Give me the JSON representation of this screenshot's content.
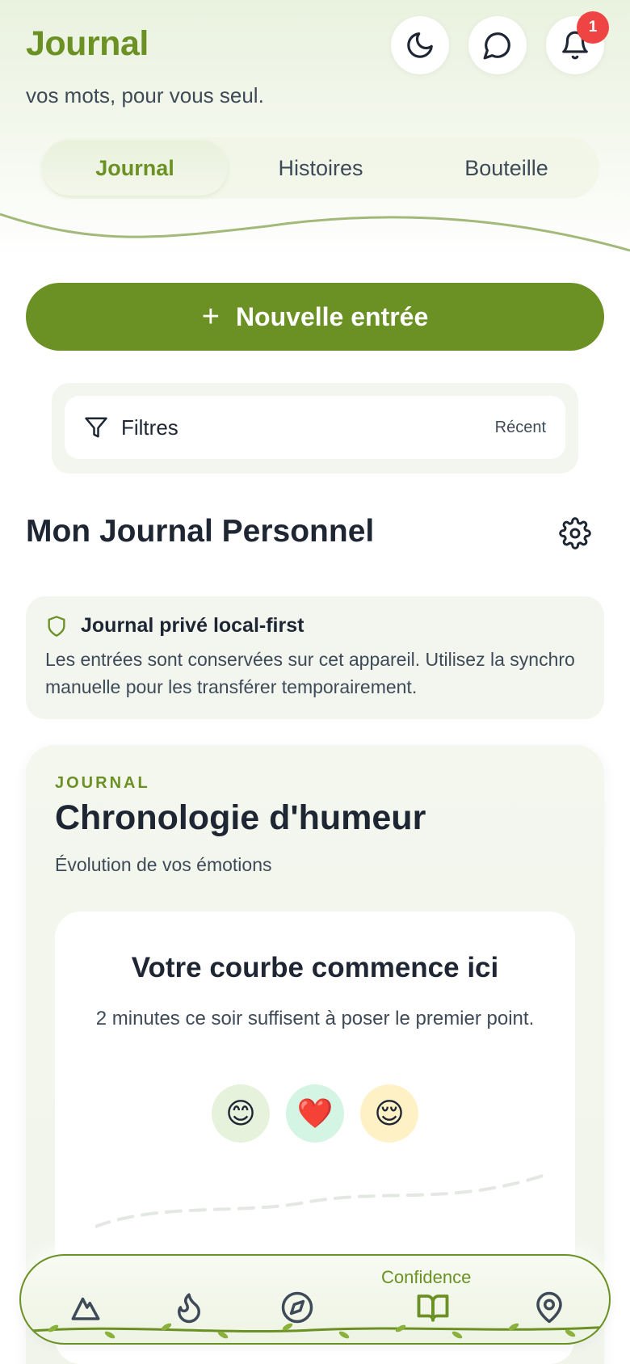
{
  "header": {
    "title": "Journal",
    "tagline": "vos mots, pour vous seul.",
    "icons": [
      "moon-icon",
      "chat-icon",
      "bell-icon"
    ],
    "notification_count": "1"
  },
  "tabs": [
    {
      "label": "Journal",
      "active": true
    },
    {
      "label": "Histoires",
      "active": false
    },
    {
      "label": "Bouteille",
      "active": false
    }
  ],
  "new_entry": {
    "icon": "plus-icon",
    "label": "Nouvelle entrée"
  },
  "filters": {
    "label": "Filtres",
    "sort": "Récent"
  },
  "section": {
    "title": "Mon Journal Personnel"
  },
  "privacy": {
    "title": "Journal privé local-first",
    "text": "Les entrées sont conservées sur cet appareil. Utilisez la synchro manuelle pour les transférer temporairement."
  },
  "mood": {
    "eyebrow": "JOURNAL",
    "title": "Chronologie d'humeur",
    "subtitle": "Évolution de vos émotions",
    "empty_title": "Votre courbe commence ici",
    "empty_text": "2 minutes ce soir suffisent à poser le premier point.",
    "emojis": [
      "😊",
      "❤️",
      "😌"
    ]
  },
  "nav": {
    "active_label": "Confidence",
    "items": [
      "mountain-icon",
      "flame-icon",
      "compass-icon",
      "book-open-icon",
      "map-pin-icon"
    ]
  },
  "colors": {
    "accent": "#6b9124",
    "badge": "#ef4444",
    "text": "#1e2633",
    "muted": "#3f4a58"
  }
}
